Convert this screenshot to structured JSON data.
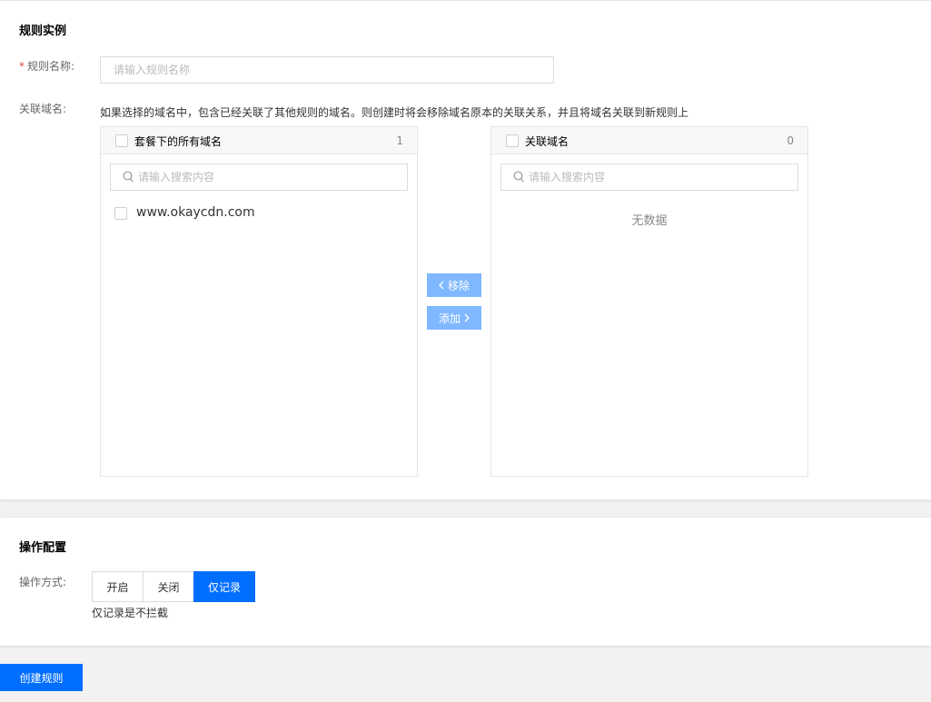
{
  "rule_section": {
    "title": "规则实例",
    "name_label": "规则名称:",
    "required_mark": "*",
    "name_input": {
      "value": "",
      "placeholder": "请输入规则名称"
    },
    "domain_label": "关联域名:",
    "hint": "如果选择的域名中，包含已经关联了其他规则的域名。则创建时将会移除域名原本的关联关系，并且将域名关联到新规则上"
  },
  "transfer": {
    "left": {
      "title": "套餐下的所有域名",
      "count": "1",
      "search_placeholder": "请输入搜索内容",
      "items": [
        {
          "label": "www.okaycdn.com"
        }
      ]
    },
    "right": {
      "title": "关联域名",
      "count": "0",
      "search_placeholder": "请输入搜索内容",
      "empty_text": "无数据"
    },
    "remove_label": "移除",
    "add_label": "添加"
  },
  "op_section": {
    "title": "操作配置",
    "mode_label": "操作方式:",
    "options": [
      "开启",
      "关闭",
      "仅记录"
    ],
    "selected": "仅记录",
    "note": "仅记录是不拦截"
  },
  "submit_label": "创建规则",
  "colors": {
    "primary": "#006eff",
    "transfer_button": "#80b8ff",
    "required": "#e54545"
  },
  "icons": {
    "search": "search-icon",
    "chevron_left": "chevron-left-icon",
    "chevron_right": "chevron-right-icon"
  }
}
